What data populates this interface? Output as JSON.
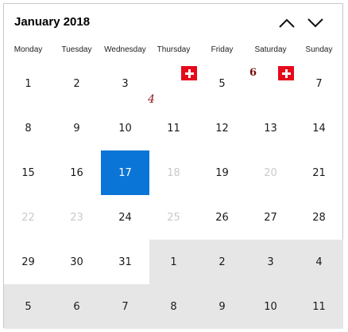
{
  "header": {
    "month_title": "January 2018",
    "prev_icon": "chevron-up-icon",
    "next_icon": "chevron-down-icon"
  },
  "weekdays": [
    "Monday",
    "Tuesday",
    "Wednesday",
    "Thursday",
    "Friday",
    "Saturday",
    "Sunday"
  ],
  "weeks": [
    [
      {
        "label": "1",
        "state": "normal"
      },
      {
        "label": "2",
        "state": "normal"
      },
      {
        "label": "3",
        "state": "normal"
      },
      {
        "label": "",
        "state": "normal",
        "flag": true
      },
      {
        "label": "5",
        "state": "normal"
      },
      {
        "label": "",
        "state": "normal",
        "flag": true
      },
      {
        "label": "7",
        "state": "normal"
      }
    ],
    [
      {
        "label": "8",
        "state": "normal"
      },
      {
        "label": "9",
        "state": "normal"
      },
      {
        "label": "10",
        "state": "normal"
      },
      {
        "label": "11",
        "state": "normal"
      },
      {
        "label": "12",
        "state": "normal"
      },
      {
        "label": "13",
        "state": "normal"
      },
      {
        "label": "14",
        "state": "normal"
      }
    ],
    [
      {
        "label": "15",
        "state": "normal"
      },
      {
        "label": "16",
        "state": "normal"
      },
      {
        "label": "17",
        "state": "selected"
      },
      {
        "label": "18",
        "state": "dim"
      },
      {
        "label": "19",
        "state": "normal"
      },
      {
        "label": "20",
        "state": "dim"
      },
      {
        "label": "21",
        "state": "normal"
      }
    ],
    [
      {
        "label": "22",
        "state": "dim"
      },
      {
        "label": "23",
        "state": "dim"
      },
      {
        "label": "24",
        "state": "normal"
      },
      {
        "label": "25",
        "state": "dim"
      },
      {
        "label": "26",
        "state": "normal"
      },
      {
        "label": "27",
        "state": "normal"
      },
      {
        "label": "28",
        "state": "normal"
      }
    ],
    [
      {
        "label": "29",
        "state": "normal"
      },
      {
        "label": "30",
        "state": "normal"
      },
      {
        "label": "31",
        "state": "normal"
      },
      {
        "label": "1",
        "state": "other"
      },
      {
        "label": "2",
        "state": "other"
      },
      {
        "label": "3",
        "state": "other"
      },
      {
        "label": "4",
        "state": "other"
      }
    ],
    [
      {
        "label": "5",
        "state": "other"
      },
      {
        "label": "6",
        "state": "other"
      },
      {
        "label": "7",
        "state": "other"
      },
      {
        "label": "8",
        "state": "other"
      },
      {
        "label": "9",
        "state": "other"
      },
      {
        "label": "10",
        "state": "other"
      },
      {
        "label": "11",
        "state": "other"
      }
    ]
  ],
  "annotations": {
    "thursday_label": "4",
    "saturday_label": "6",
    "flag_icon": "swiss-flag-icon"
  },
  "colors": {
    "selected": "#0a75d6",
    "other_month_bg": "#e6e6e6",
    "dim_text": "#c9c9c9",
    "flag_red": "#e5091b"
  }
}
